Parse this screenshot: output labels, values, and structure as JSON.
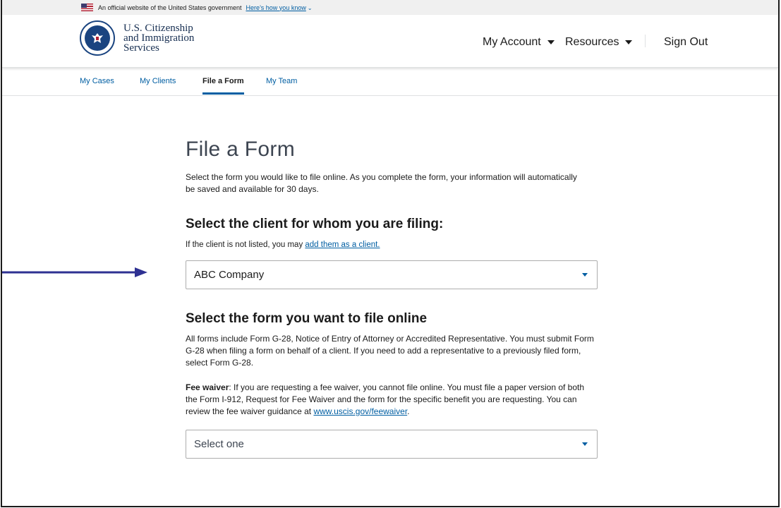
{
  "gov_banner": {
    "text": "An official website of the United States government",
    "link": "Here’s how you know"
  },
  "header": {
    "brand_line1": "U.S. Citizenship",
    "brand_line2": "and Immigration",
    "brand_line3": "Services",
    "nav": {
      "my_account": "My Account",
      "resources": "Resources",
      "sign_out": "Sign Out"
    }
  },
  "tabs": [
    {
      "label": "My Cases",
      "active": false
    },
    {
      "label": "My Clients",
      "active": false
    },
    {
      "label": "File a Form",
      "active": true
    },
    {
      "label": "My Team",
      "active": false
    }
  ],
  "main": {
    "title": "File a Form",
    "intro": "Select the form you would like to file online. As you complete the form, your information will automatically be saved and available for 30 days.",
    "client_section": {
      "heading": "Select the client for whom you are filing:",
      "hint_prefix": "If the client is not listed, you may ",
      "hint_link": "add them as a client.",
      "select_value": "ABC Company"
    },
    "form_section": {
      "heading": "Select the form you want to file online",
      "para1": "All forms include Form G-28, Notice of Entry of Attorney or Accredited Representative. You must submit Form G-28 when filing a form on behalf of a client. If you need to add a representative to a previously filed form, select Form G-28.",
      "fee_label": "Fee waiver",
      "fee_text": ": If you are requesting a fee waiver, you cannot file online. You must file a paper version of both the Form I-912, Request for Fee Waiver and the form for the specific benefit you are requesting. You can review the fee waiver guidance at ",
      "fee_link": "www.uscis.gov/feewaiver",
      "fee_end": ".",
      "select_placeholder": "Select one"
    }
  },
  "colors": {
    "link": "#005ea2",
    "brand": "#162e51",
    "arrow": "#2e3192"
  },
  "icons": {
    "flag": "us-flag-icon",
    "seal": "dhs-seal-icon",
    "caret": "caret-down-icon",
    "arrow": "right-arrow-icon"
  }
}
